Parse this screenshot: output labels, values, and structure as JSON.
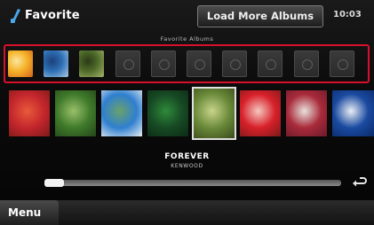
{
  "header": {
    "title": "Favorite",
    "load_more_label": "Load More Albums",
    "clock": "10:03",
    "favorite_albums_label": "Favorite Albums"
  },
  "favorites": [
    {
      "kind": "art",
      "colors": [
        "#f5b32a",
        "#d2621a",
        "#fbe6a0"
      ]
    },
    {
      "kind": "art",
      "colors": [
        "#2d6fb4",
        "#a9c7e6",
        "#1e3f7a"
      ]
    },
    {
      "kind": "art",
      "colors": [
        "#4f6b2a",
        "#a6b56b",
        "#2a3a16"
      ]
    },
    {
      "kind": "empty"
    },
    {
      "kind": "empty"
    },
    {
      "kind": "empty"
    },
    {
      "kind": "empty"
    },
    {
      "kind": "empty"
    },
    {
      "kind": "empty"
    },
    {
      "kind": "empty"
    }
  ],
  "albums": [
    {
      "colors": [
        "#c4262c",
        "#e85a3a",
        "#7a1a1a"
      ]
    },
    {
      "colors": [
        "#3f7a2a",
        "#9ac06a",
        "#24461a"
      ]
    },
    {
      "colors": [
        "#2f7fd0",
        "#6aa26a",
        "#e8eef2"
      ]
    },
    {
      "colors": [
        "#174a24",
        "#2e8a3a",
        "#0b2a14"
      ]
    },
    {
      "colors": [
        "#6a8a3a",
        "#c8d48a",
        "#3a4a1a"
      ]
    },
    {
      "colors": [
        "#d8202a",
        "#f4c8c0",
        "#7a1a1a"
      ]
    },
    {
      "colors": [
        "#a82a3a",
        "#e8e2dc",
        "#6a1a2a"
      ]
    },
    {
      "colors": [
        "#1a4aa0",
        "#eaeef4",
        "#0a2a6a"
      ]
    }
  ],
  "selected_album_index": 4,
  "now_playing": {
    "title": "FOREVER",
    "artist": "KENWOOD"
  },
  "scroll": {
    "position_fraction": 0.0
  },
  "bottom": {
    "menu_label": "Menu"
  },
  "colors": {
    "highlight": "#d8102b",
    "accent_icon": "#4aa8e8"
  },
  "icons": {
    "favorite": "music-note-icon",
    "return": "return-arrow-icon"
  }
}
